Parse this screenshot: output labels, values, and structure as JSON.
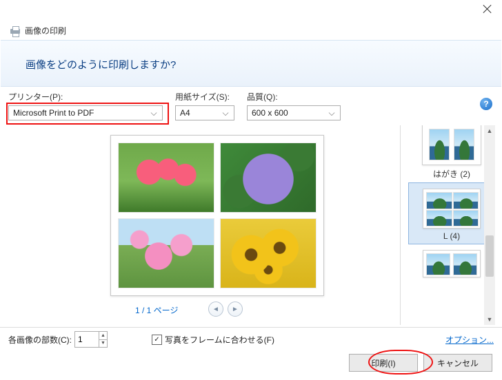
{
  "window": {
    "title": "画像の印刷",
    "question": "画像をどのように印刷しますか?"
  },
  "controls": {
    "printer_label": "プリンター(P):",
    "printer_value": "Microsoft Print to PDF",
    "paper_label": "用紙サイズ(S):",
    "paper_value": "A4",
    "quality_label": "品質(Q):",
    "quality_value": "600 x 600"
  },
  "preview": {
    "page_label": "1 / 1 ページ"
  },
  "layouts": [
    {
      "label": "はがき (2)"
    },
    {
      "label": "L (4)"
    },
    {
      "label": ""
    }
  ],
  "bottom": {
    "copies_label": "各画像の部数(C):",
    "copies_value": "1",
    "fit_label": "写真をフレームに合わせる(F)",
    "fit_checked": true,
    "options_link": "オプション..."
  },
  "actions": {
    "print_label": "印刷(I)",
    "cancel_label": "キャンセル"
  }
}
